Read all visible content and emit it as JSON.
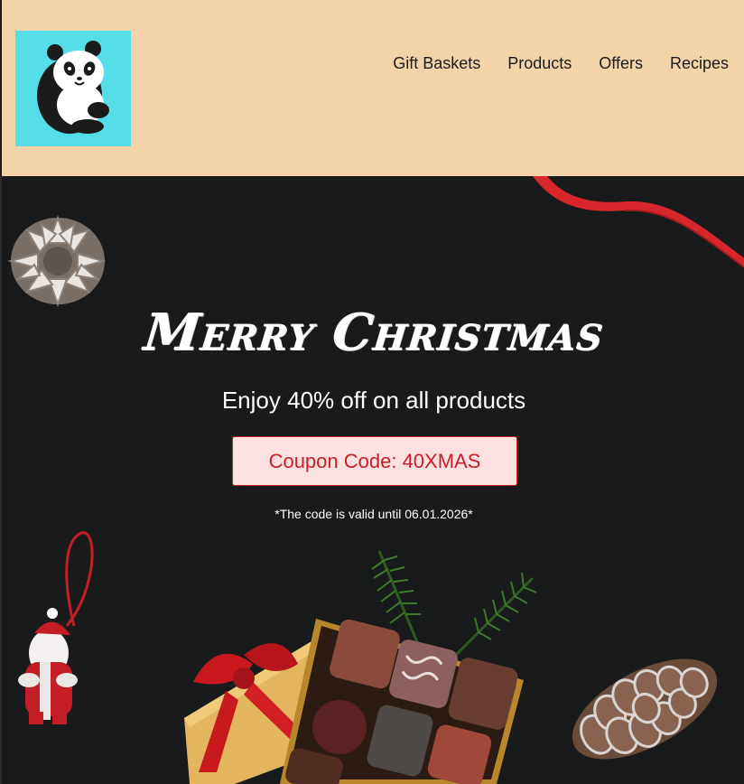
{
  "header": {
    "logo_icon": "panda-logo-icon",
    "nav": [
      {
        "label": "Gift Baskets"
      },
      {
        "label": "Products"
      },
      {
        "label": "Offers"
      },
      {
        "label": "Recipes"
      }
    ]
  },
  "hero": {
    "title": "Merry Christmas",
    "subtitle": "Enjoy 40% off on all products",
    "coupon": "Coupon Code: 40XMAS",
    "note": "*The code is valid until 06.01.2026*",
    "decorations": [
      "pine-cone-icon",
      "ribbon-icon",
      "santa-ornament-icon",
      "chocolate-box-icon",
      "pine-branch-icon"
    ]
  },
  "colors": {
    "header_bg": "#f5d3a9",
    "logo_bg": "#55dde8",
    "hero_bg": "#181a1b",
    "coupon_bg": "#fde1e1",
    "accent_red": "#c71f28"
  }
}
